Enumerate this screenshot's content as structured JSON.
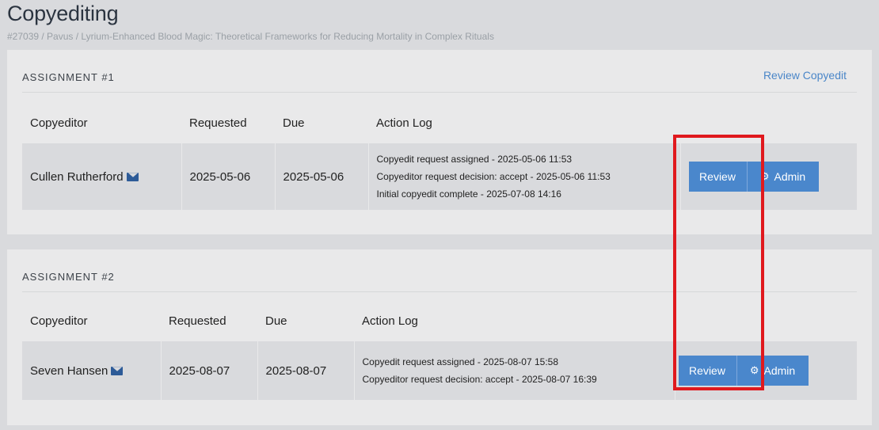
{
  "page": {
    "title": "Copyediting",
    "breadcrumb": "#27039 / Pavus / Lyrium-Enhanced Blood Magic: Theoretical Frameworks for Reducing Mortality in Complex Rituals"
  },
  "columns": {
    "copyeditor": "Copyeditor",
    "requested": "Requested",
    "due": "Due",
    "action_log": "Action Log"
  },
  "assignments": [
    {
      "heading": "ASSIGNMENT #1",
      "review_copyedit_link": "Review Copyedit",
      "copyeditor": "Cullen Rutherford",
      "requested": "2025-05-06",
      "due": "2025-05-06",
      "log": [
        "Copyedit request assigned - 2025-05-06 11:53",
        "Copyeditor request decision: accept - 2025-05-06 11:53",
        "Initial copyedit complete - 2025-07-08 14:16"
      ],
      "review_label": "Review",
      "admin_label": "Admin"
    },
    {
      "heading": "ASSIGNMENT #2",
      "copyeditor": "Seven Hansen",
      "requested": "2025-08-07",
      "due": "2025-08-07",
      "log": [
        "Copyedit request assigned - 2025-08-07 15:58",
        "Copyeditor request decision: accept - 2025-08-07 16:39"
      ],
      "review_label": "Review",
      "admin_label": "Admin"
    }
  ],
  "icons": {
    "mail": "envelope-icon",
    "gear": "gear-icon"
  },
  "colors": {
    "accent": "#4a87cc",
    "highlight": "#e0191e"
  }
}
